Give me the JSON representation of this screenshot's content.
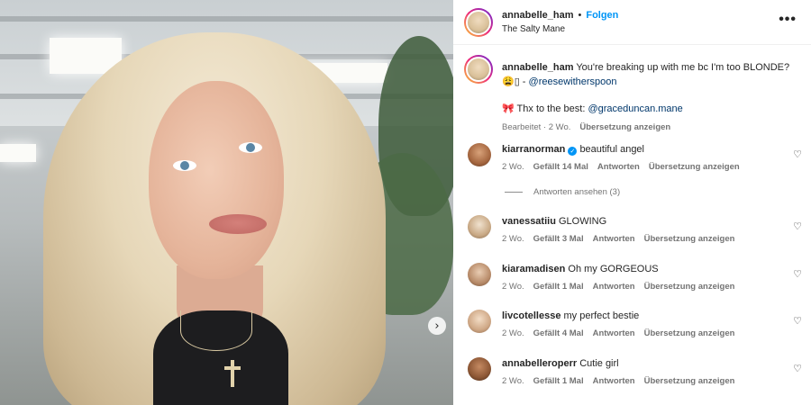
{
  "post": {
    "author": "annabelle_ham",
    "separator": "•",
    "follow_label": "Folgen",
    "location": "The Salty Mane",
    "more_icon": "more-horizontal-icon"
  },
  "caption": {
    "author": "annabelle_ham",
    "text": "You're breaking up with me bc I'm too BLONDE?",
    "emoji_line_prefix": "😩▯ -",
    "mention1": "@reesewitherspoon",
    "line2_prefix": "🎀 Thx to the best:",
    "mention2": "@graceduncan.mane",
    "edited": "Bearbeitet · 2 Wo.",
    "translate": "Übersetzung anzeigen"
  },
  "comments": [
    {
      "user": "kiarranorman",
      "verified": true,
      "text": "beautiful angel",
      "age": "2 Wo.",
      "likes": "Gefällt 14 Mal",
      "reply": "Antworten",
      "translate": "Übersetzung anzeigen"
    },
    {
      "user": "vanessatiiu",
      "verified": false,
      "text": "GLOWING",
      "age": "2 Wo.",
      "likes": "Gefällt 3 Mal",
      "reply": "Antworten",
      "translate": "Übersetzung anzeigen"
    },
    {
      "user": "kiaramadisen",
      "verified": false,
      "text": "Oh my GORGEOUS",
      "age": "2 Wo.",
      "likes": "Gefällt 1 Mal",
      "reply": "Antworten",
      "translate": "Übersetzung anzeigen"
    },
    {
      "user": "livcotellesse",
      "verified": false,
      "text": "my perfect bestie",
      "age": "2 Wo.",
      "likes": "Gefällt 4 Mal",
      "reply": "Antworten",
      "translate": "Übersetzung anzeigen"
    },
    {
      "user": "annabelleroperr",
      "verified": false,
      "text": "Cutie girl",
      "age": "2 Wo.",
      "likes": "Gefällt 1 Mal",
      "reply": "Antworten",
      "translate": "Übersetzung anzeigen"
    }
  ],
  "view_replies": "Antworten ansehen (3)",
  "icons": {
    "like": "heart-icon",
    "next": "chevron-right-icon",
    "verified": "verified-badge-icon"
  },
  "colors": {
    "accent": "#0095f6",
    "mention": "#00376b",
    "muted": "#737373"
  }
}
